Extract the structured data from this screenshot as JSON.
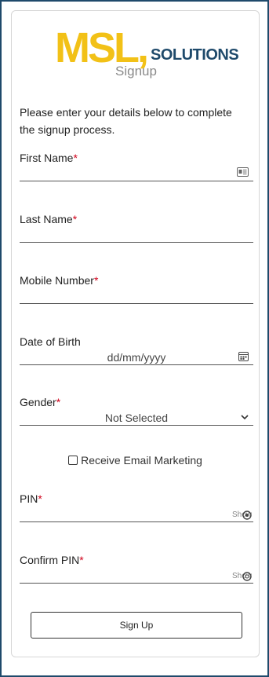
{
  "brand": {
    "logo_main": "MSL,",
    "logo_secondary": "SOLUTIONS",
    "page_subtitle": "Signup"
  },
  "intro_text": "Please enter your details below to complete the signup process.",
  "fields": {
    "first_name": {
      "label": "First Name",
      "required_mark": "*",
      "icon": "contact-card-icon"
    },
    "last_name": {
      "label": "Last Name",
      "required_mark": "*"
    },
    "mobile_number": {
      "label": "Mobile Number",
      "required_mark": "*"
    },
    "date_of_birth": {
      "label": "Date of Birth",
      "placeholder": "dd/mm/yyyy",
      "icon": "calendar-icon"
    },
    "gender": {
      "label": "Gender",
      "required_mark": "*",
      "selected": "Not Selected"
    },
    "email_marketing": {
      "label": "Receive Email Marketing",
      "checked": false
    },
    "pin": {
      "label": "PIN",
      "required_mark": "*",
      "toggle": "Show"
    },
    "confirm_pin": {
      "label": "Confirm PIN",
      "required_mark": "*",
      "toggle": "Show"
    }
  },
  "submit_label": "Sign Up",
  "colors": {
    "brand_yellow": "#f2c117",
    "brand_navy": "#1f4a6b",
    "required_red": "#d0021b"
  }
}
